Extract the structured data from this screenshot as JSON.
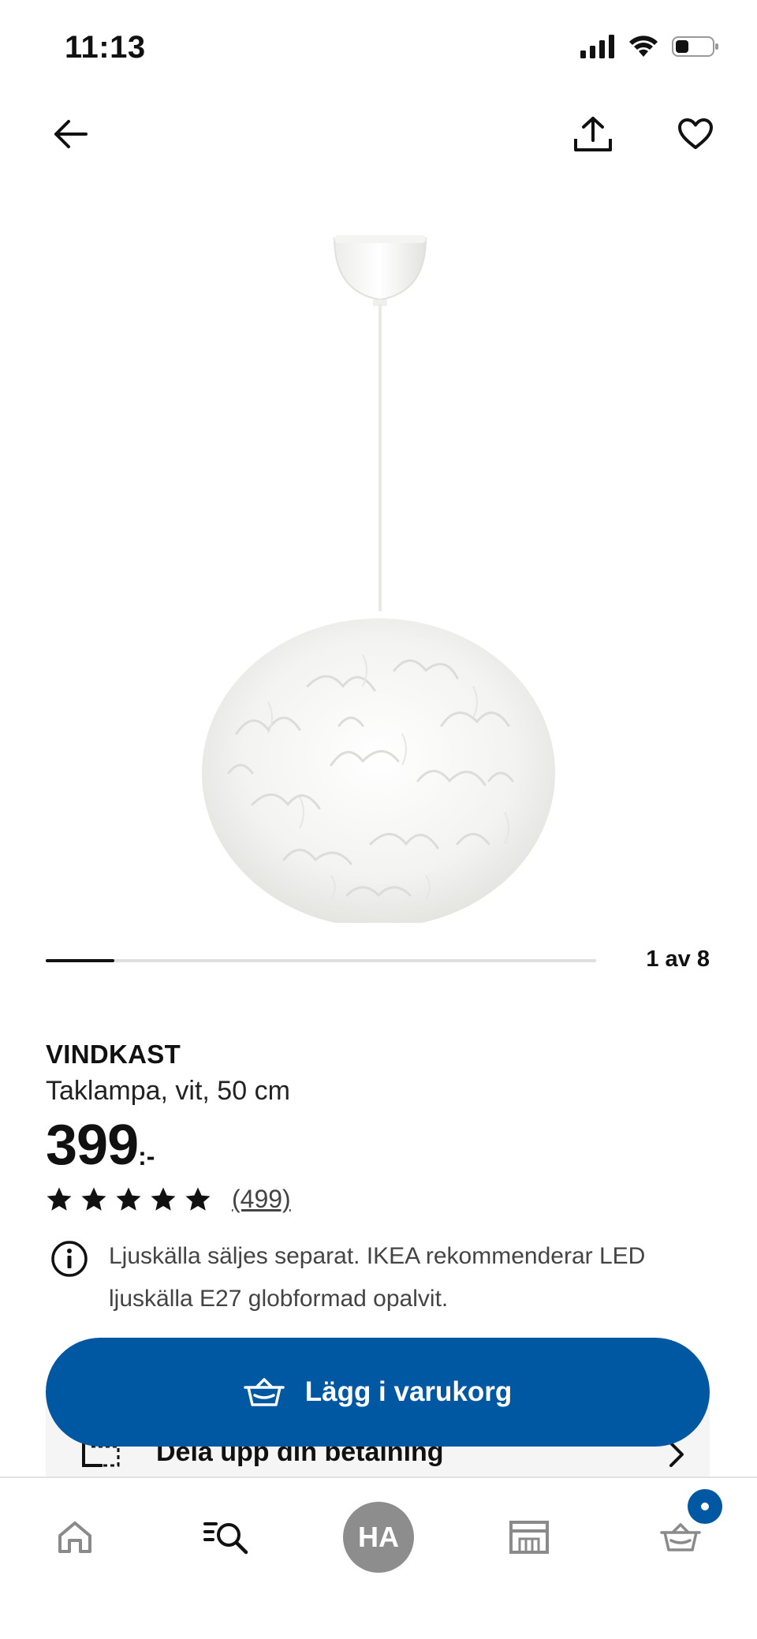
{
  "status_bar": {
    "time": "11:13"
  },
  "icons": {
    "back": "arrow-left-icon",
    "share": "share-icon",
    "favourite": "heart-icon",
    "info": "info-icon",
    "cart": "basket-icon",
    "installment": "card-icon",
    "chevron": "chevron-right-icon"
  },
  "carousel": {
    "counter": "1 av 8",
    "progress": 0.125
  },
  "product": {
    "name": "VINDKAST",
    "description": "Taklampa, vit, 50 cm",
    "price_integer": "399",
    "price_suffix": ":-",
    "rating_stars": 5,
    "review_count": "(499)",
    "info_text": "Ljuskälla säljes separat. IKEA rekommenderar LED ljuskälla E27 globformad opalvit."
  },
  "actions": {
    "add_to_cart": "Lägg i varukorg",
    "installment": "Dela upp din betalning"
  },
  "tab_bar": {
    "profile_initials": "HA"
  },
  "colors": {
    "brand_blue": "#0058a3",
    "text": "#111111",
    "avatar_grey": "#8d8d8d"
  }
}
